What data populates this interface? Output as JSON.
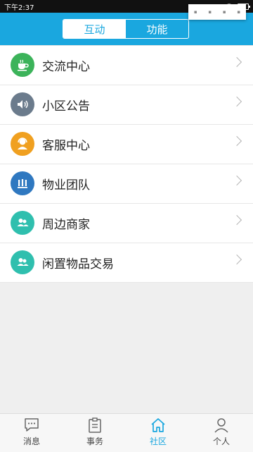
{
  "status_bar": {
    "time": "下午2:37",
    "signal_dots": "....",
    "icons": [
      "wifi-icon",
      "battery-icon"
    ]
  },
  "header": {
    "tabs": [
      {
        "label": "互动",
        "active": true
      },
      {
        "label": "功能",
        "active": false
      }
    ]
  },
  "list": {
    "items": [
      {
        "label": "交流中心",
        "icon": "cup-icon",
        "color": "#3cb35a"
      },
      {
        "label": "小区公告",
        "icon": "speaker-icon",
        "color": "#6b7b8c"
      },
      {
        "label": "客服中心",
        "icon": "customer-service-icon",
        "color": "#f0a020"
      },
      {
        "label": "物业团队",
        "icon": "team-icon",
        "color": "#2f78c0"
      },
      {
        "label": "周边商家",
        "icon": "people-icon",
        "color": "#2fbfae"
      },
      {
        "label": "闲置物品交易",
        "icon": "people-icon",
        "color": "#2fbfae"
      }
    ]
  },
  "tabbar": {
    "items": [
      {
        "label": "消息",
        "icon": "message-icon",
        "active": false
      },
      {
        "label": "事务",
        "icon": "clipboard-icon",
        "active": false
      },
      {
        "label": "社区",
        "icon": "home-icon",
        "active": true
      },
      {
        "label": "个人",
        "icon": "person-icon",
        "active": false
      }
    ]
  },
  "colors": {
    "brand": "#1aa7df",
    "background": "#efefef"
  }
}
